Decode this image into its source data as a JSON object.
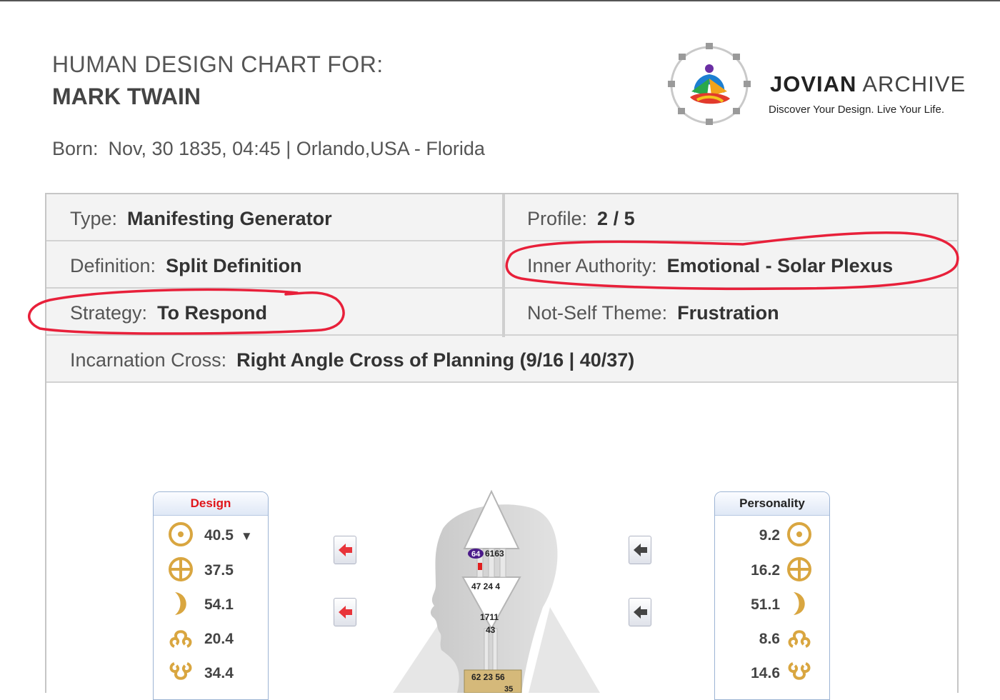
{
  "header": {
    "subtitle": "HUMAN DESIGN CHART FOR:",
    "name": "MARK TWAIN",
    "born_label": "Born:",
    "born_value": "Nov, 30 1835, 04:45 | Orlando,USA - Florida"
  },
  "brand": {
    "name_bold": "JOVIAN",
    "name_light": " ARCHIVE",
    "tagline": "Discover Your Design. Live Your Life."
  },
  "chart_info": {
    "type": {
      "label": "Type:",
      "value": "Manifesting Generator"
    },
    "profile": {
      "label": "Profile:",
      "value": "2 / 5"
    },
    "definition": {
      "label": "Definition:",
      "value": "Split Definition"
    },
    "inner_authority": {
      "label": "Inner Authority:",
      "value": "Emotional - Solar Plexus"
    },
    "strategy": {
      "label": "Strategy:",
      "value": "To Respond"
    },
    "not_self_theme": {
      "label": "Not-Self Theme:",
      "value": "Frustration"
    },
    "incarnation_cross": {
      "label": "Incarnation Cross:",
      "value": "Right Angle Cross of Planning (9/16 | 40/37)"
    }
  },
  "annotations": {
    "circle_color": "#e8203a",
    "circled_fields": [
      "Inner Authority",
      "Strategy"
    ]
  },
  "design_panel": {
    "title": "Design",
    "title_color": "#e0151a",
    "rows": [
      {
        "planet": "sun-icon",
        "value": "40.5",
        "marker": "▼"
      },
      {
        "planet": "earth-icon",
        "value": "37.5",
        "marker": ""
      },
      {
        "planet": "moon-icon",
        "value": "54.1",
        "marker": ""
      },
      {
        "planet": "north-node-icon",
        "value": "20.4",
        "marker": ""
      },
      {
        "planet": "south-node-icon",
        "value": "34.4",
        "marker": ""
      }
    ]
  },
  "personality_panel": {
    "title": "Personality",
    "rows": [
      {
        "planet": "sun-icon",
        "value": "9.2"
      },
      {
        "planet": "earth-icon",
        "value": "16.2"
      },
      {
        "planet": "moon-icon",
        "value": "51.1"
      },
      {
        "planet": "north-node-icon",
        "value": "8.6"
      },
      {
        "planet": "south-node-icon",
        "value": "14.6"
      }
    ]
  },
  "bodygraph": {
    "head_gates_badge": "64",
    "head_gates": "6163",
    "ajna_gates": "47 24 4",
    "ajna_gates_lower_1": "1711",
    "ajna_gates_lower_2": "43",
    "throat_gates": "62 23 56",
    "throat_gates_partial": "35"
  }
}
